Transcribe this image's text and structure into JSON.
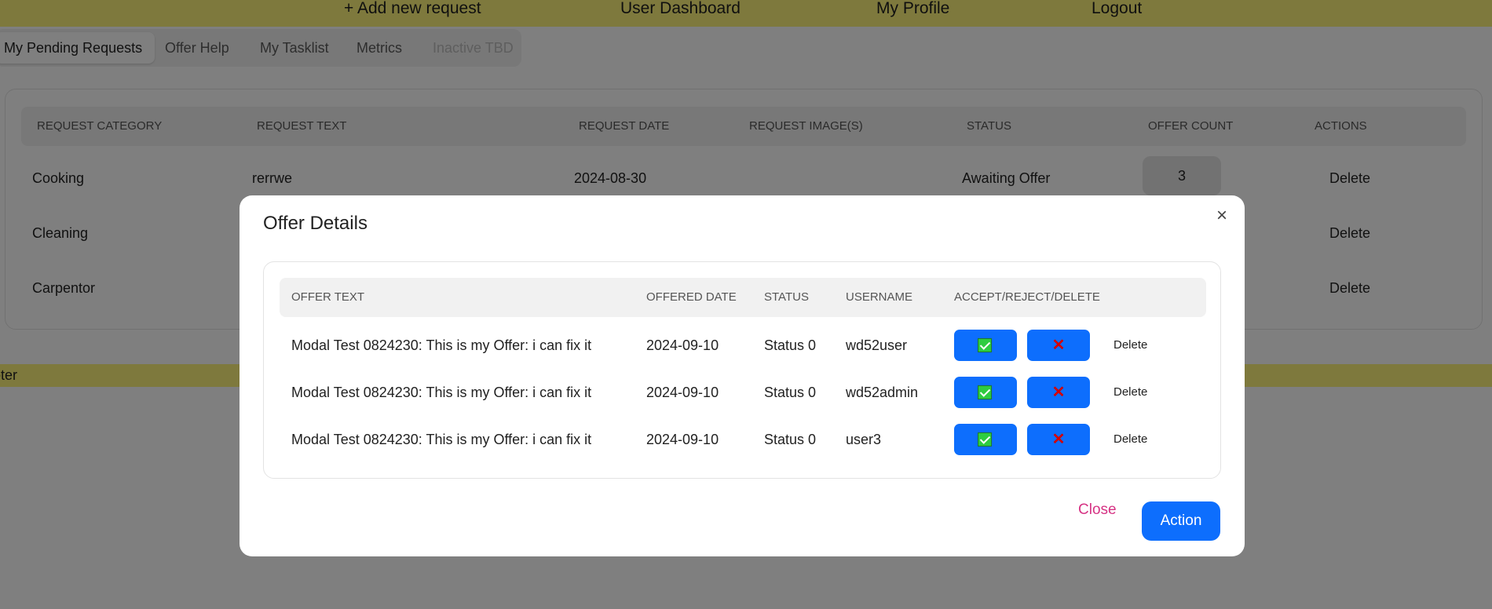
{
  "topnav": {
    "add_request": "+ Add new request",
    "dashboard": "User Dashboard",
    "profile": "My Profile",
    "logout": "Logout"
  },
  "tabs": [
    {
      "label": "My Pending Requests"
    },
    {
      "label": "Offer Help"
    },
    {
      "label": "My Tasklist"
    },
    {
      "label": "Metrics"
    },
    {
      "label": "Inactive TBD"
    }
  ],
  "requests_table": {
    "headers": [
      "REQUEST CATEGORY",
      "REQUEST TEXT",
      "REQUEST DATE",
      "REQUEST IMAGE(S)",
      "STATUS",
      "OFFER COUNT",
      "ACTIONS"
    ],
    "rows": [
      {
        "category": "Cooking",
        "text": "rerrwe",
        "date": "2024-08-30",
        "status": "Awaiting Offer",
        "offer_count": "3",
        "action": "Delete"
      },
      {
        "category": "Cleaning",
        "action": "Delete"
      },
      {
        "category": "Carpentor",
        "action": "Delete"
      }
    ]
  },
  "footer": {
    "text": "ooter"
  },
  "modal": {
    "title": "Offer Details",
    "close_x": "×",
    "headers": [
      "OFFER TEXT",
      "OFFERED DATE",
      "STATUS",
      "USERNAME",
      "ACCEPT/REJECT/DELETE"
    ],
    "rows": [
      {
        "offer_text": "Modal Test 0824230: This is my Offer: i can fix it",
        "date": "2024-09-10",
        "status": "Status 0",
        "username": "wd52user",
        "delete": "Delete"
      },
      {
        "offer_text": "Modal Test 0824230: This is my Offer: i can fix it",
        "date": "2024-09-10",
        "status": "Status 0",
        "username": "wd52admin",
        "delete": "Delete"
      },
      {
        "offer_text": "Modal Test 0824230: This is my Offer: i can fix it",
        "date": "2024-09-10",
        "status": "Status 0",
        "username": "user3",
        "delete": "Delete"
      }
    ],
    "close_label": "Close",
    "action_label": "Action"
  },
  "colors": {
    "nav_bg": "#fdf37a",
    "primary": "#0d6efd",
    "close_link": "#d63384"
  }
}
